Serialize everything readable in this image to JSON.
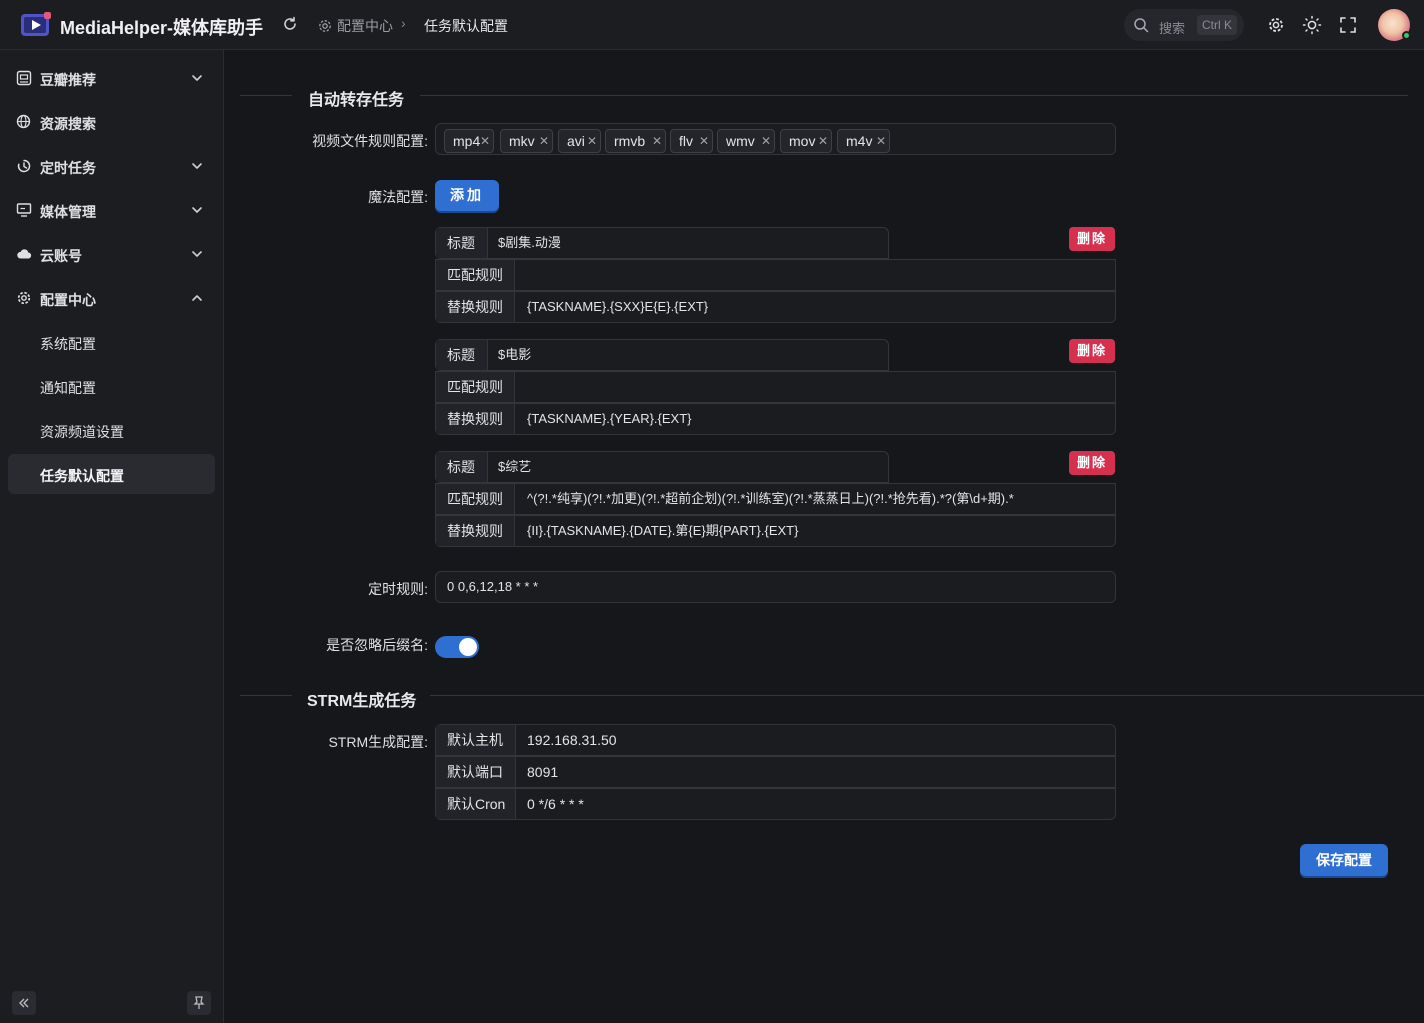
{
  "header": {
    "app_title": "MediaHelper-媒体库助手",
    "breadcrumb": [
      "配置中心",
      "任务默认配置"
    ],
    "search_placeholder": "搜索",
    "search_shortcut": "Ctrl K"
  },
  "sidebar": {
    "items": [
      {
        "label": "豆瓣推荐",
        "icon": "douban-icon",
        "expandable": true
      },
      {
        "label": "资源搜索",
        "icon": "resource-search-icon",
        "expandable": false
      },
      {
        "label": "定时任务",
        "icon": "timer-icon",
        "expandable": true
      },
      {
        "label": "媒体管理",
        "icon": "media-icon",
        "expandable": true
      },
      {
        "label": "云账号",
        "icon": "cloud-icon",
        "expandable": true
      },
      {
        "label": "配置中心",
        "icon": "gear-icon",
        "expandable": true,
        "expanded": true
      }
    ],
    "sub_items": [
      "系统配置",
      "通知配置",
      "资源频道设置",
      "任务默认配置"
    ],
    "active_sub": "任务默认配置"
  },
  "auto_transfer": {
    "section_title": "自动转存任务",
    "video_rules_label": "视频文件规则配置:",
    "video_extensions": [
      "mp4",
      "mkv",
      "avi",
      "rmvb",
      "flv",
      "wmv",
      "mov",
      "m4v"
    ],
    "magic_label": "魔法配置:",
    "add_button": "添加",
    "delete_button": "删除",
    "field_title": "标题",
    "field_match": "匹配规则",
    "field_replace": "替换规则",
    "magic_rules": [
      {
        "title": "$剧集.动漫",
        "match": "",
        "replace": "{TASKNAME}.{SXX}E{E}.{EXT}"
      },
      {
        "title": "$电影",
        "match": "",
        "replace": "{TASKNAME}.{YEAR}.{EXT}"
      },
      {
        "title": "$综艺",
        "match": "^(?!.*纯享)(?!.*加更)(?!.*超前企划)(?!.*训练室)(?!.*蒸蒸日上)(?!.*抢先看).*?(第\\d+期).*",
        "replace": "{II}.{TASKNAME}.{DATE}.第{E}期{PART}.{EXT}"
      }
    ],
    "cron_label": "定时规则:",
    "cron_value": "0 0,6,12,18 * * *",
    "ignore_ext_label": "是否忽略后缀名:",
    "ignore_ext_enabled": true
  },
  "strm": {
    "section_title": "STRM生成任务",
    "config_label": "STRM生成配置:",
    "fields": [
      {
        "label": "默认主机",
        "value": "192.168.31.50"
      },
      {
        "label": "默认端口",
        "value": "8091"
      },
      {
        "label": "默认Cron",
        "value": "0 */6 * * *"
      }
    ]
  },
  "save_button": "保存配置",
  "colors": {
    "accent": "#2f6fd1",
    "danger": "#d6304f",
    "background": "#16171b"
  }
}
